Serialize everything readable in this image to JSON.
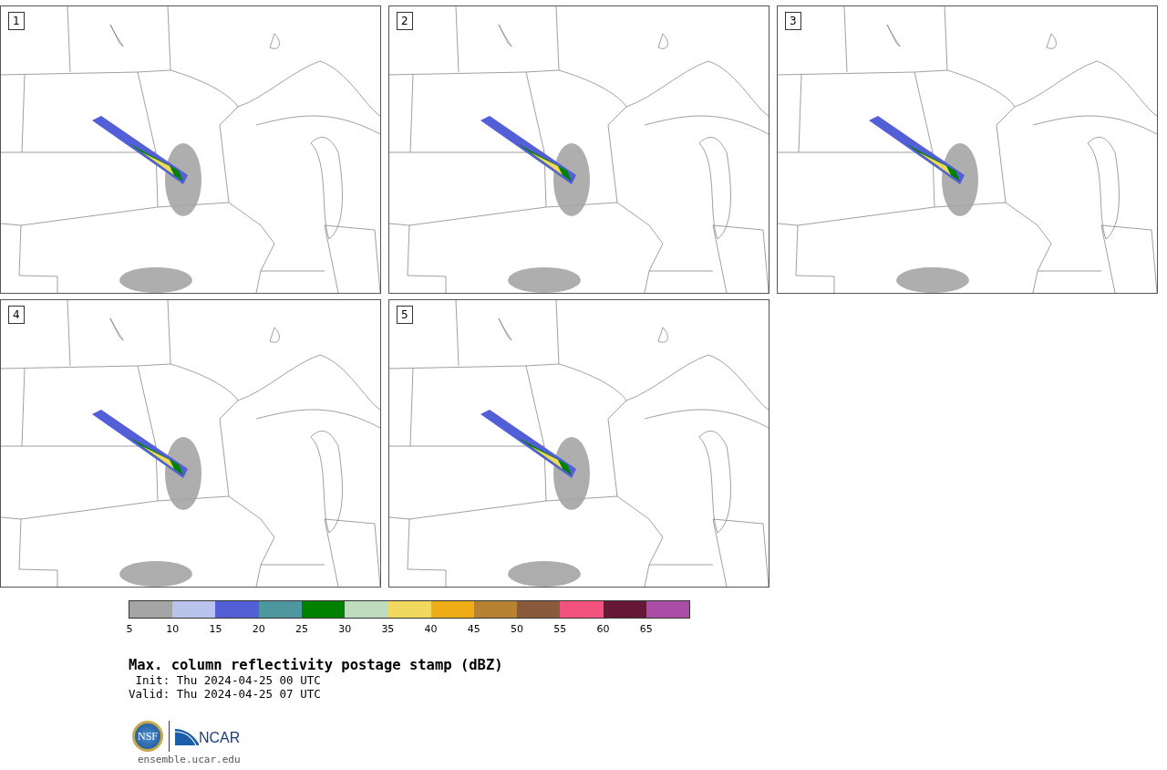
{
  "panels": [
    {
      "label": "1"
    },
    {
      "label": "2"
    },
    {
      "label": "3"
    },
    {
      "label": "4"
    },
    {
      "label": "5"
    }
  ],
  "colorbar": {
    "segments": [
      {
        "color": "#a5a5a5"
      },
      {
        "color": "#b9c3ec"
      },
      {
        "color": "#525fd7"
      },
      {
        "color": "#4f979f"
      },
      {
        "color": "#008200"
      },
      {
        "color": "#bfdcbf"
      },
      {
        "color": "#f0d95e"
      },
      {
        "color": "#efad17"
      },
      {
        "color": "#b88233"
      },
      {
        "color": "#8a5a3c"
      },
      {
        "color": "#f4527e"
      },
      {
        "color": "#661836"
      },
      {
        "color": "#ab4ca6"
      }
    ],
    "ticks": [
      "5",
      "10",
      "15",
      "20",
      "25",
      "30",
      "35",
      "40",
      "45",
      "50",
      "55",
      "60",
      "65"
    ]
  },
  "title": "Max. column reflectivity postage stamp (dBZ)",
  "init": " Init: Thu 2024-04-25 00 UTC",
  "valid": "Valid: Thu 2024-04-25 07 UTC",
  "logo": {
    "nsf": "NSF",
    "ncar": "NCAR"
  },
  "url": "ensemble.ucar.edu"
}
